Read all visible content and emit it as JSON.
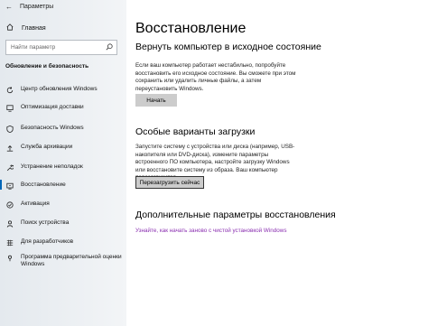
{
  "window": {
    "title": "Параметры"
  },
  "sidebar": {
    "home_label": "Главная",
    "search_placeholder": "Найти параметр",
    "section_title": "Обновление и безопасность",
    "items": [
      {
        "label": "Центр обновления Windows",
        "icon": "refresh-icon"
      },
      {
        "label": "Оптимизация доставки",
        "icon": "delivery-icon"
      },
      {
        "label": "Безопасность Windows",
        "icon": "shield-icon"
      },
      {
        "label": "Служба архивации",
        "icon": "backup-icon"
      },
      {
        "label": "Устранение неполадок",
        "icon": "wrench-icon"
      },
      {
        "label": "Восстановление",
        "icon": "recovery-icon",
        "active": true
      },
      {
        "label": "Активация",
        "icon": "check-circle-icon"
      },
      {
        "label": "Поиск устройства",
        "icon": "person-location-icon"
      },
      {
        "label": "Для разработчиков",
        "icon": "developer-icon"
      },
      {
        "label": "Программа предварительной оценки Windows",
        "icon": "insider-icon"
      }
    ]
  },
  "main": {
    "title": "Восстановление",
    "reset": {
      "heading": "Вернуть компьютер в исходное состояние",
      "description": "Если ваш компьютер работает нестабильно, попробуйте восстановить его исходное состояние. Вы сможете при этом сохранить или удалить личные файлы, а затем переустановить Windows.",
      "button": "Начать"
    },
    "advanced_startup": {
      "heading": "Особые варианты загрузки",
      "description": "Запустите систему с устройства или диска (например, USB-накопителя или DVD-диска), измените параметры встроенного ПО компьютера, настройте загрузку Windows или восстановите систему из образа. Ваш компьютер перезагрузится.",
      "button": "Перезагрузить сейчас"
    },
    "more": {
      "heading": "Дополнительные параметры восстановления",
      "link": "Узнайте, как начать заново с чистой установкой Windows"
    }
  },
  "colors": {
    "accent": "#0067b8",
    "link": "#8a2fb0",
    "button": "#cccccc"
  }
}
